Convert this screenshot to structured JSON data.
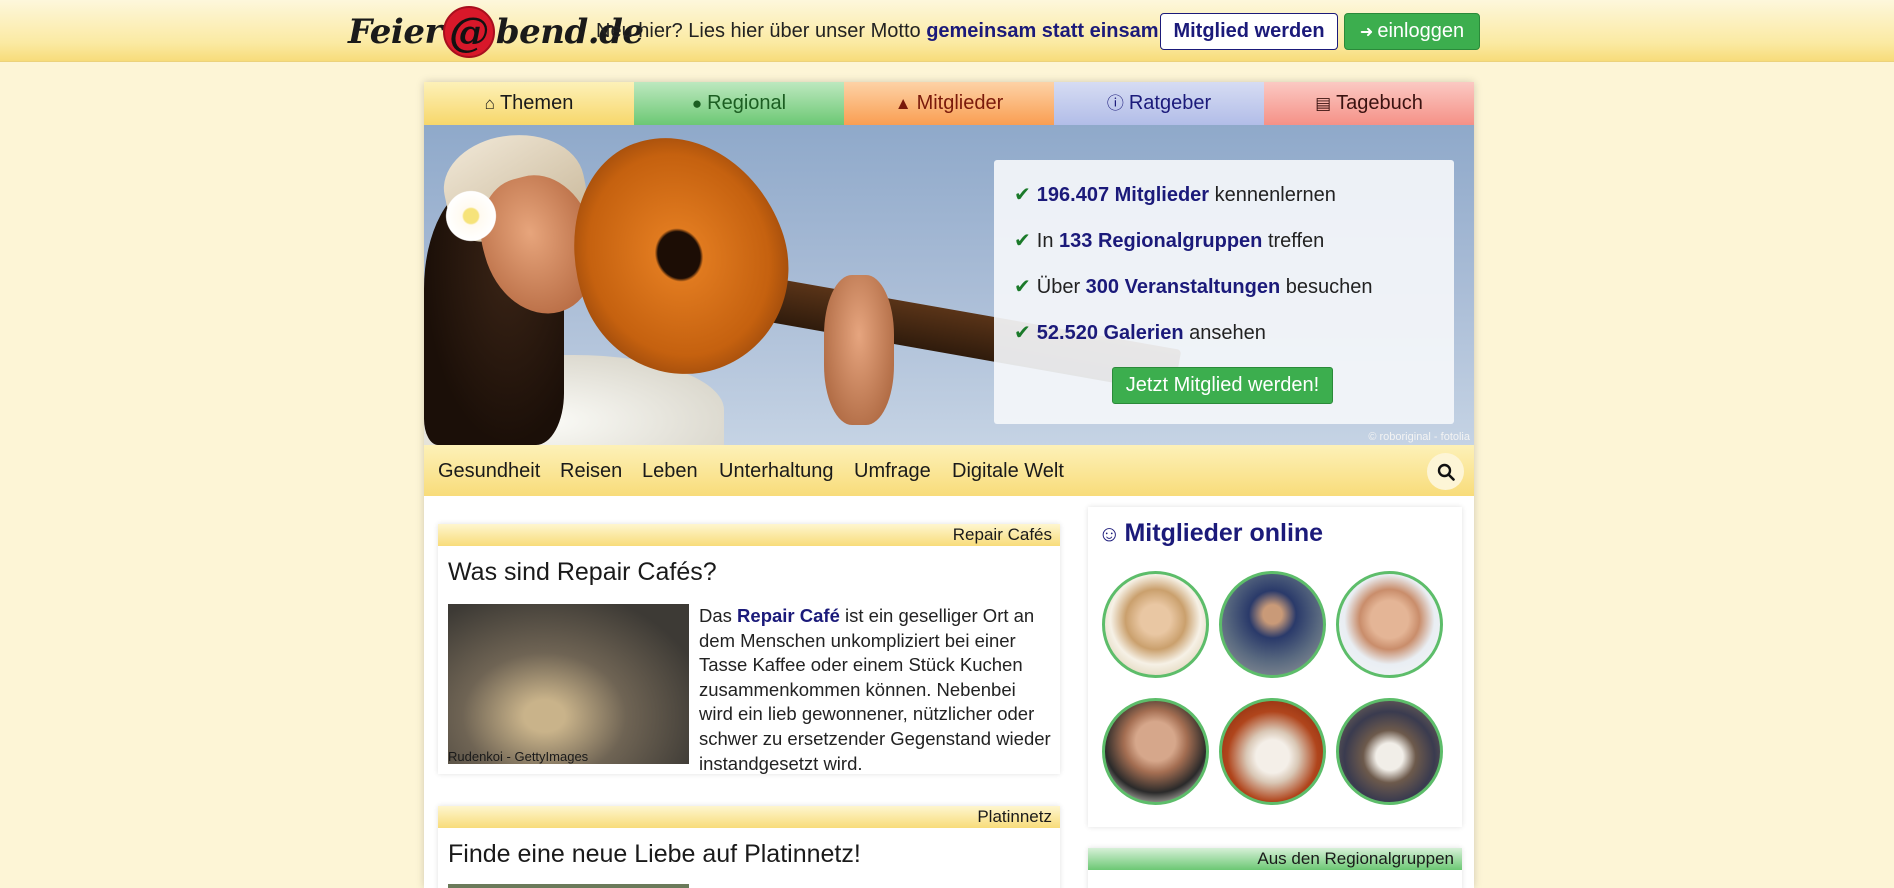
{
  "header": {
    "logo": {
      "part1": "Feier",
      "at": "@",
      "part2": "bend",
      "part3": ".de"
    },
    "motto_prefix": "Neu hier? Lies hier über unser Motto",
    "motto_link": "gemeinsam statt einsam",
    "motto_suffix": ".",
    "member_button": "Mitglied werden",
    "login_button": "einloggen"
  },
  "nav": {
    "tabs": [
      {
        "label": "Themen",
        "icon": "home-icon"
      },
      {
        "label": "Regional",
        "icon": "globe-icon"
      },
      {
        "label": "Mitglieder",
        "icon": "user-icon"
      },
      {
        "label": "Ratgeber",
        "icon": "info-icon"
      },
      {
        "label": "Tagebuch",
        "icon": "book-icon"
      }
    ]
  },
  "hero": {
    "credit": "© roboriginal - fotolia",
    "stats": [
      {
        "pre": "",
        "bold": "196.407 Mitglieder",
        "post": " kennenlernen"
      },
      {
        "pre": "In ",
        "bold": "133 Regionalgruppen",
        "post": " treffen"
      },
      {
        "pre": "Über ",
        "bold": "300 Veranstaltungen",
        "post": " besuchen"
      },
      {
        "pre": "",
        "bold": "52.520 Galerien",
        "post": " ansehen"
      }
    ],
    "cta": "Jetzt Mitglied werden!"
  },
  "subnav": {
    "items": [
      "Gesundheit",
      "Reisen",
      "Leben",
      "Unterhaltung",
      "Umfrage",
      "Digitale Welt"
    ]
  },
  "articles": [
    {
      "category": "Repair Cafés",
      "title": "Was sind Repair Cafés?",
      "image_caption": "Rudenkoi - GettyImages",
      "text_pre": "Das ",
      "text_bold": "Repair Café",
      "text_post": " ist ein geselliger Ort an dem Menschen unkompliziert bei einer Tasse Kaffee oder einem Stück Kuchen zusammenkommen können. Nebenbei wird ein lieb gewonnener, nützlicher oder schwer zu ersetzender Gegenstand wieder instandgesetzt wird."
    },
    {
      "category": "Platinnetz",
      "title": "Finde eine neue Liebe auf Platinnetz!"
    }
  ],
  "online": {
    "title": "Mitglieder online"
  },
  "regional_box": {
    "strip": "Aus den Regionalgruppen"
  },
  "colors": {
    "brand_blue": "#1b1a7a",
    "green_button": "#3cae4e",
    "page_bg": "#fdf5d6"
  }
}
